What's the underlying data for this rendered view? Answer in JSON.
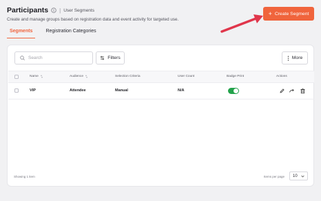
{
  "header": {
    "title": "Participants",
    "breadcrumb": "User Segments",
    "separator": "|",
    "subtitle": "Create and manage groups based on registration data and event activity for targeted use."
  },
  "actions": {
    "create_label": "Create Segment",
    "create_color": "#f0643c"
  },
  "annotation": {
    "arrow_color": "#e0364b",
    "arrow_icon": "red-arrow"
  },
  "tabs": [
    {
      "label": "Segments",
      "active": true
    },
    {
      "label": "Registration Categories",
      "active": false
    }
  ],
  "toolbar": {
    "search_placeholder": "Search",
    "filters_label": "Filters",
    "more_label": "More"
  },
  "table": {
    "columns": [
      "Name",
      "Audience",
      "Selection Criteria",
      "User Count",
      "Badge Print",
      "Actions"
    ],
    "rows": [
      {
        "name": "VIP",
        "audience": "Attendee",
        "selection_criteria": "Manual",
        "user_count": "N/A",
        "badge_print": true
      }
    ]
  },
  "footer": {
    "showing": "Showing 1 item",
    "items_per_page_label": "Items per page",
    "page_size": "10"
  },
  "colors": {
    "accent": "#f0643c",
    "toggle_on": "#22a24b"
  }
}
